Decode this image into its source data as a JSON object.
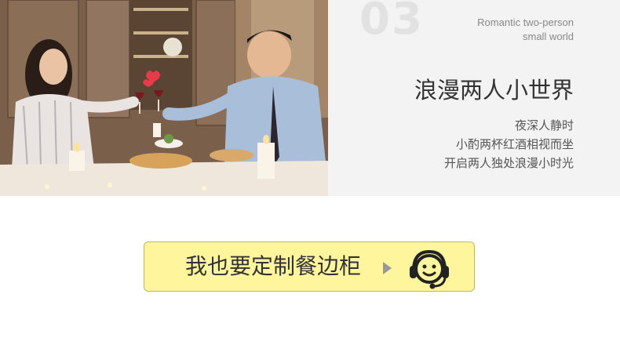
{
  "section": {
    "number": "03",
    "subtitle_en_line1": "Romantic two-person",
    "subtitle_en_line2": "small world",
    "title": "浪漫两人小世界",
    "lines": [
      "夜深人静时",
      "小酌两杯红酒相视而坐",
      "开启两人独处浪漫小时光"
    ]
  },
  "photo": {
    "subject": "couple toasting with red wine at candlelit dinner"
  },
  "cta": {
    "label": "我也要定制餐边柜",
    "arrow_icon": "play-triangle-icon",
    "service_icon": "customer-service-headset-icon",
    "background": "#fff59d",
    "border": "#c2b46a"
  }
}
